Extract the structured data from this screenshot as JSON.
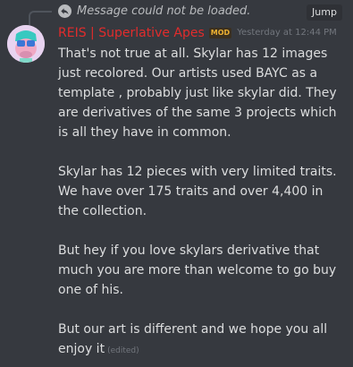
{
  "reply": {
    "icon": "reply-icon",
    "text": "Message could not be loaded.",
    "jump_label": "Jump"
  },
  "author": {
    "name": "REIS | Superlative Apes",
    "name_color": "#e22c2c",
    "badge": "MOD",
    "timestamp": "Yesterday at 12:44 PM"
  },
  "message": {
    "paragraphs": [
      "That's not true at all. Skylar has 12 images just recolored. Our artists used BAYC as a template , probably just like skylar did. They are derivatives of the same 3 projects which is all they have in common.",
      "Skylar has 12 pieces with very limited traits. We have over 175 traits and over 4,400 in the collection.",
      "But hey if you love skylars derivative that much you are more than welcome to go buy one of his.",
      "But our art is different and we hope you all enjoy it"
    ],
    "edited_label": "(edited)"
  }
}
